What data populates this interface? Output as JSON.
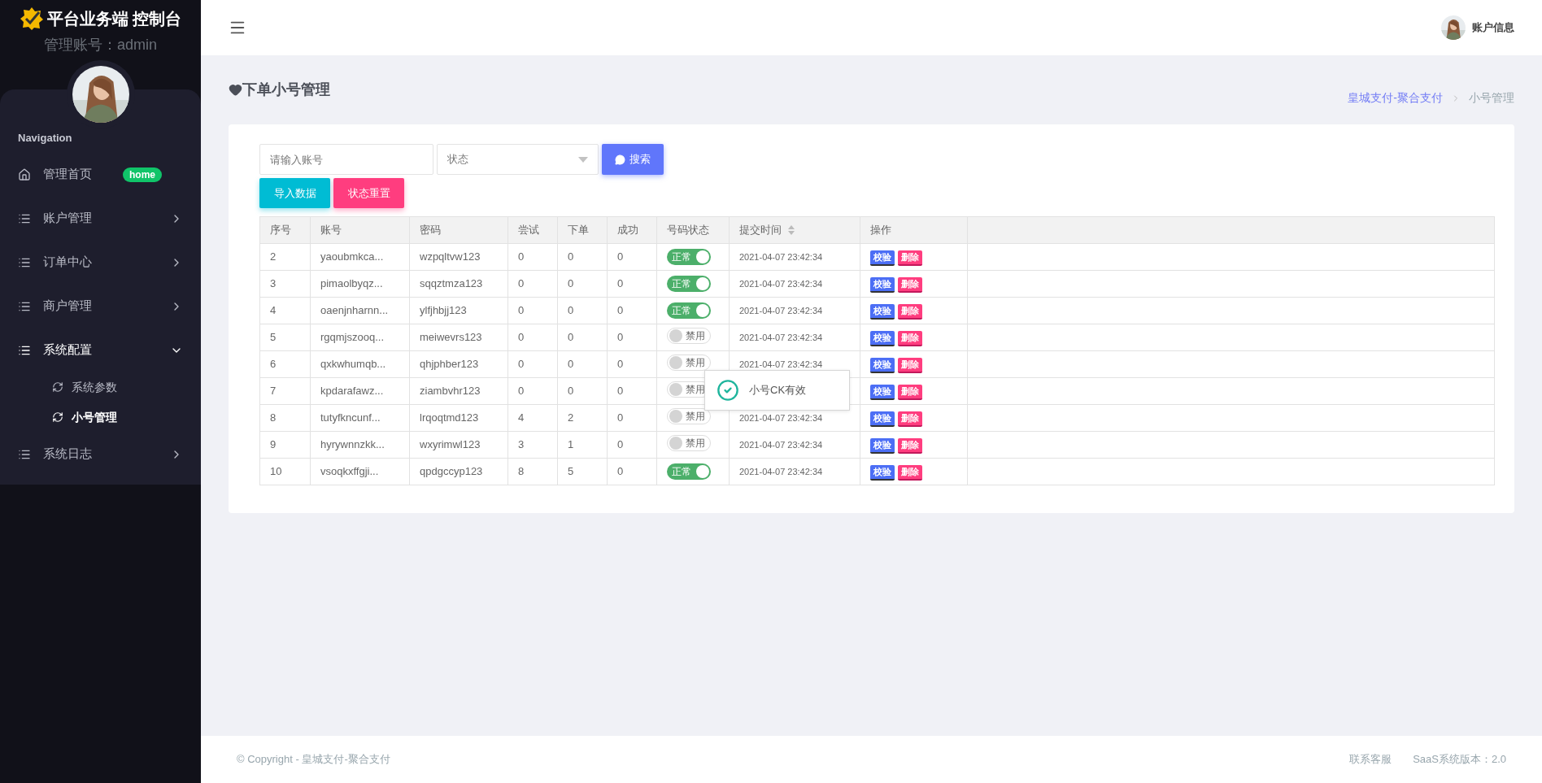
{
  "brand": {
    "title": "平台业务端 控制台",
    "account": "管理账号：admin"
  },
  "sidebar": {
    "heading": "Navigation",
    "items": [
      {
        "kind": "home",
        "label": "管理首页",
        "badge": "home"
      },
      {
        "kind": "menu",
        "label": "账户管理",
        "expanded": false
      },
      {
        "kind": "menu",
        "label": "订单中心",
        "expanded": false
      },
      {
        "kind": "menu",
        "label": "商户管理",
        "expanded": false
      },
      {
        "kind": "menu",
        "label": "系统配置",
        "expanded": true,
        "children": [
          {
            "label": "系统参数",
            "selected": false
          },
          {
            "label": "小号管理",
            "selected": true
          }
        ]
      },
      {
        "kind": "menu",
        "label": "系统日志",
        "expanded": false
      }
    ]
  },
  "topbar": {
    "account_label": "账户信息"
  },
  "page": {
    "title": "下单小号管理",
    "breadcrumb": [
      {
        "kind": "link",
        "label": "皇城支付-聚合支付"
      },
      {
        "kind": "current",
        "label": "小号管理"
      }
    ]
  },
  "filters": {
    "account_placeholder": "请输入账号",
    "status_placeholder": "状态",
    "search_button": "搜索",
    "buttons": [
      {
        "kind": "import",
        "label": "导入数据"
      },
      {
        "kind": "reset",
        "label": "状态重置"
      }
    ]
  },
  "table": {
    "columns": [
      {
        "label": "序号",
        "sortable": false
      },
      {
        "label": "账号",
        "sortable": false
      },
      {
        "label": "密码",
        "sortable": false
      },
      {
        "label": "尝试",
        "sortable": false
      },
      {
        "label": "下单",
        "sortable": false
      },
      {
        "label": "成功",
        "sortable": false
      },
      {
        "label": "号码状态",
        "sortable": false
      },
      {
        "label": "提交时间",
        "sortable": true
      },
      {
        "label": "操作",
        "sortable": false
      }
    ],
    "rows": [
      {
        "index": "2",
        "account": "yaoubmkca...",
        "password": "wzpqltvw123",
        "tries": "0",
        "orders": "0",
        "success": "0",
        "status": "正常",
        "on": true,
        "time": "2021-04-07 23:42:34",
        "actions": [
          "校验",
          "删除"
        ]
      },
      {
        "index": "3",
        "account": "pimaolbyqz...",
        "password": "sqqztmza123",
        "tries": "0",
        "orders": "0",
        "success": "0",
        "status": "正常",
        "on": true,
        "time": "2021-04-07 23:42:34",
        "actions": [
          "校验",
          "删除"
        ]
      },
      {
        "index": "4",
        "account": "oaenjnharnn...",
        "password": "ylfjhbjj123",
        "tries": "0",
        "orders": "0",
        "success": "0",
        "status": "正常",
        "on": true,
        "time": "2021-04-07 23:42:34",
        "actions": [
          "校验",
          "删除"
        ]
      },
      {
        "index": "5",
        "account": "rgqmjszooq...",
        "password": "meiwevrs123",
        "tries": "0",
        "orders": "0",
        "success": "0",
        "status": "禁用",
        "on": false,
        "time": "2021-04-07 23:42:34",
        "actions": [
          "校验",
          "删除"
        ]
      },
      {
        "index": "6",
        "account": "qxkwhumqb...",
        "password": "qhjphber123",
        "tries": "0",
        "orders": "0",
        "success": "0",
        "status": "禁用",
        "on": false,
        "time": "2021-04-07 23:42:34",
        "actions": [
          "校验",
          "删除"
        ]
      },
      {
        "index": "7",
        "account": "kpdarafawz...",
        "password": "ziambvhr123",
        "tries": "0",
        "orders": "0",
        "success": "0",
        "status": "禁用",
        "on": false,
        "actions": [
          "校验",
          "删除"
        ]
      },
      {
        "index": "8",
        "account": "tutyfkncunf...",
        "password": "lrqoqtmd123",
        "tries": "4",
        "orders": "2",
        "success": "0",
        "status": "禁用",
        "on": false,
        "time": "2021-04-07 23:42:34",
        "actions": [
          "校验",
          "删除"
        ]
      },
      {
        "index": "9",
        "account": "hyrywnnzkk...",
        "password": "wxyrimwl123",
        "tries": "3",
        "orders": "1",
        "success": "0",
        "status": "禁用",
        "on": false,
        "time": "2021-04-07 23:42:34",
        "actions": [
          "校验",
          "删除"
        ]
      },
      {
        "index": "10",
        "account": "vsoqkxffgji...",
        "password": "qpdgccyp123",
        "tries": "8",
        "orders": "5",
        "success": "0",
        "status": "正常",
        "on": true,
        "time": "2021-04-07 23:42:34",
        "actions": [
          "校验",
          "删除"
        ]
      }
    ]
  },
  "toast": {
    "message": "小号CK有效"
  },
  "footer": {
    "copyright": "© Copyright - 皇城支付-聚合支付",
    "links": [
      "联系客服",
      "SaaS系统版本：2.0"
    ]
  }
}
